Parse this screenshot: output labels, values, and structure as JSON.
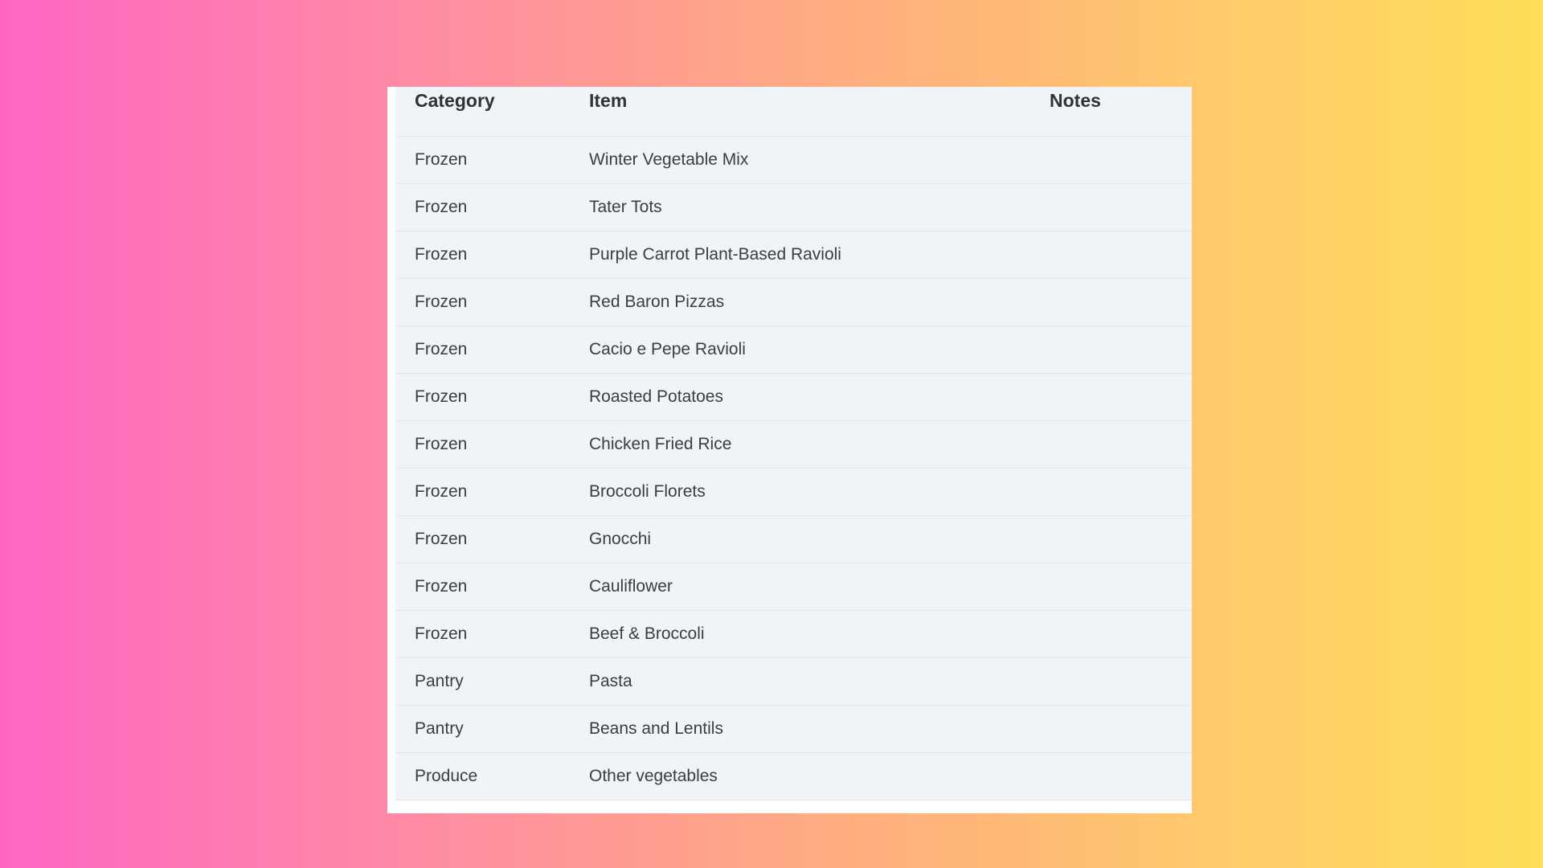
{
  "table": {
    "headers": {
      "category": "Category",
      "item": "Item",
      "notes": "Notes"
    },
    "rows": [
      {
        "category": "Frozen",
        "item": "Winter Vegetable Mix",
        "notes": ""
      },
      {
        "category": "Frozen",
        "item": "Tater Tots",
        "notes": ""
      },
      {
        "category": "Frozen",
        "item": "Purple Carrot Plant-Based Ravioli",
        "notes": ""
      },
      {
        "category": "Frozen",
        "item": "Red Baron Pizzas",
        "notes": ""
      },
      {
        "category": "Frozen",
        "item": "Cacio e Pepe Ravioli",
        "notes": ""
      },
      {
        "category": "Frozen",
        "item": "Roasted Potatoes",
        "notes": ""
      },
      {
        "category": "Frozen",
        "item": "Chicken Fried Rice",
        "notes": ""
      },
      {
        "category": "Frozen",
        "item": "Broccoli Florets",
        "notes": ""
      },
      {
        "category": "Frozen",
        "item": "Gnocchi",
        "notes": ""
      },
      {
        "category": "Frozen",
        "item": "Cauliflower",
        "notes": ""
      },
      {
        "category": "Frozen",
        "item": "Beef & Broccoli",
        "notes": ""
      },
      {
        "category": "Pantry",
        "item": "Pasta",
        "notes": ""
      },
      {
        "category": "Pantry",
        "item": "Beans and Lentils",
        "notes": ""
      },
      {
        "category": "Produce",
        "item": "Other vegetables",
        "notes": ""
      }
    ]
  }
}
